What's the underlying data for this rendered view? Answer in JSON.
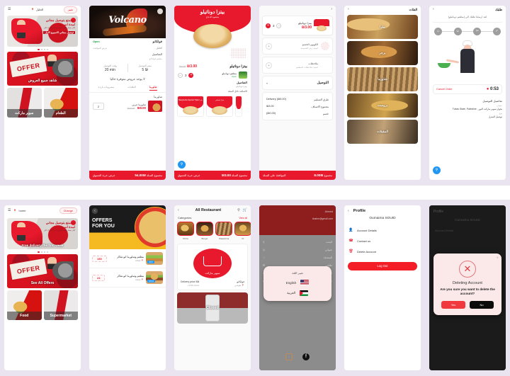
{
  "panels": {
    "home_ar": {
      "name": "home-arabic",
      "topbar": {
        "menu_icon": "hamburger-icon",
        "location_icon": "pin-icon",
        "location": "الخليل",
        "change_label": "تغيير"
      },
      "banner1": {
        "line1": "استمتع بتوصيل مجاني",
        "line2": "لمدة اسبوع",
        "line3": "اكثر بسعار قليلة متوفرة عندنا اشترك الان",
        "line4": "توصيل مجاني الاسبوع الاول",
        "overlay": ""
      },
      "banner2": {
        "stamp": "OFFER",
        "overlay": "شاهد جميع العروض"
      },
      "categories": [
        {
          "label": "الطعام"
        },
        {
          "label": "سوبر ماركت"
        }
      ]
    },
    "volcano": {
      "name": "restaurant-volcano",
      "hero_word": "Volcano",
      "restaurant_name": "فولكانو",
      "open_label": "Open",
      "location": "الخليل",
      "hours_label": "عرض المواقيت",
      "details_title": "التفاصيل",
      "details_sub": "مطعم فولكانو",
      "stats": [
        {
          "key": "سعر التوصيل",
          "value": "5 ₪"
        },
        {
          "key": "وقت التوصيل",
          "value": "20 min"
        }
      ],
      "note": "لا يوجد عروض متوفرة حاليا",
      "tabs": [
        {
          "label": "شاورما",
          "active": true
        },
        {
          "label": "الطلبات",
          "active": false
        },
        {
          "label": "مشروبات باردة",
          "active": false
        }
      ],
      "section_title": "شاورما",
      "product": {
        "name": "شاورما عربي",
        "price": "₪8.00",
        "old_price": "₪10.00",
        "qty": "2"
      },
      "footer": {
        "total_label": "مجموع السلة",
        "total": "₪54.00",
        "action": "عرض عربة التسوق"
      }
    },
    "pizza_detail": {
      "name": "product-detail-pizza",
      "hero_title": "بيتزا دوناتيلو",
      "hero_sub": "بحشوة الدجاج",
      "product_name": "بيتزا دوناتيلو",
      "price": "₪3.00",
      "old_price": "₪4.00",
      "restaurant": "مطعم دوناتيلو",
      "restaurant_status": "Open",
      "qty": "3",
      "details_title": "التفاصيل",
      "details_text": "بيتزا دوناتيلو",
      "details_note": "الاضافة داخل السلة",
      "related": [
        {
          "title": "بيتزا شيشي"
        },
        {
          "title": "بيتزا Margherita Special Triple"
        }
      ],
      "footer": {
        "total_label": "مجموع السلة",
        "total": "3.00₪",
        "action": "عرض عربة التسوق"
      }
    },
    "cart": {
      "name": "cart-checkout",
      "back_icon": "chevron-right-icon",
      "item": {
        "name": "بيتزا دوناتيلو",
        "price": "₪3.00",
        "qty": "3"
      },
      "coupon": {
        "title": "الكوبون الخصم",
        "sub": "اضف رمز القسيمة"
      },
      "notes": {
        "title": "ملاحظات",
        "sub": "اضف ملاحظات للمطعم"
      },
      "delivery_select": {
        "label": "التوصيل",
        "caret": "chevron-down-icon"
      },
      "summary": [
        {
          "key": "طرق التسليم",
          "value": "Delivery (₪5.00)"
        },
        {
          "key": "مجموع الاصناف",
          "value": "₪3.00"
        },
        {
          "key": "خصم",
          "value": "(₪0.00)"
        }
      ],
      "footer": {
        "total_label": "مجموع",
        "total": "₪8.00",
        "action": "الموافقة على السلة"
      }
    },
    "categories": {
      "name": "categories-list",
      "back_icon": "chevron-right-icon",
      "title": "الفئات",
      "items": [
        {
          "label": "بيتزا"
        },
        {
          "label": "برجر"
        },
        {
          "label": "شاورما"
        },
        {
          "label": "بروست"
        },
        {
          "label": "المقبلات"
        }
      ]
    },
    "tracking": {
      "name": "order-tracking",
      "back_icon": "chevron-right-icon",
      "title": "طلبك",
      "subtitle": "لقد ارسلنا طلبك الى (مطعم دوناتيلو)",
      "steps": [
        {
          "icon": "home-icon"
        },
        {
          "icon": "cook-icon"
        },
        {
          "icon": "utensils-icon"
        },
        {
          "icon": "check-icon"
        }
      ],
      "cancel_label": "Cancel Order",
      "timer": "0:53",
      "details_title": "تفاصيل التوصيل",
      "address_key": "عنوان",
      "address_value": "بجوار سوبر ماركت النور , Tubas State, Palestine",
      "type_key": "نوع",
      "type_value": "توصيل المنزل",
      "fab_icon": "search-icon"
    },
    "home_en": {
      "name": "home-english",
      "topbar": {
        "menu_icon": "hamburger-icon",
        "location_icon": "pin-icon",
        "location": "home",
        "change_label": "Change"
      },
      "banner1": {
        "line1": "استمتع بتوصيل مجاني",
        "line2": "لمدة اسبوع",
        "line3": "اكثر بسعار قليلة متوفرة عندنا اشترك الان",
        "overlay": "Free delivery the first week"
      },
      "banner2": {
        "stamp": "OFFER",
        "overlay": "See All Offers"
      },
      "categories": [
        {
          "label": "Food"
        },
        {
          "label": "Supermarket"
        }
      ]
    },
    "offers": {
      "name": "offers-for-you",
      "back_icon": "chevron-left-icon",
      "hero_line1": "OFFERS",
      "hero_line2": "FOR YOU",
      "rows": [
        {
          "name": "مطعم وشاورما ابو شاكر",
          "location": "tubas",
          "price": "150",
          "discount": "5 Off"
        },
        {
          "name": "مطعم وشاورما ابو شاكر",
          "location": "tubas",
          "price": "24",
          "discount": "24 Off"
        }
      ]
    },
    "all_restaurant": {
      "name": "all-restaurant",
      "back_icon": "chevron-left-icon",
      "title": "All Restaurant",
      "search_icon": "search-icon",
      "cart_icon": "cart-icon",
      "categories_label": "Categories",
      "view_all_label": "View all",
      "category_pills": [
        {
          "label": "Pizza"
        },
        {
          "label": "Burger"
        },
        {
          "label": "Shawarma"
        },
        {
          "label": "Pr"
        }
      ],
      "restaurant": {
        "logo_text": "سوبر ماركت",
        "name": "فولكانو",
        "location": "طوباس",
        "delivery_label": "Delivery price 5₪",
        "distance": "0.54.13 km"
      },
      "closed_label": "Closed"
    },
    "language": {
      "name": "language-drawer",
      "header_name": "Ahmed",
      "header_email": "tinahm@gmail.com",
      "menu": [
        {
          "label": "البحث",
          "icon": "search-icon"
        },
        {
          "label": "عنواني",
          "icon": "pin-icon"
        },
        {
          "label": "المفضلة",
          "icon": "heart-icon"
        },
        {
          "label": "طلباتي",
          "icon": "receipt-icon"
        },
        {
          "label": "الملف الشخصي",
          "icon": "user-icon"
        },
        {
          "label": "تغيير اللغة",
          "icon": "globe-icon"
        }
      ],
      "popup": {
        "title": "تغيير اللغة",
        "options": [
          {
            "label": "English",
            "flag": "us-flag-icon"
          },
          {
            "label": "العربية",
            "flag": "palestine-flag-icon"
          }
        ]
      },
      "social": [
        {
          "icon": "instagram-icon"
        },
        {
          "icon": "facebook-icon"
        }
      ]
    },
    "profile": {
      "name": "profile",
      "back_icon": "chevron-left-icon",
      "title": "Profile",
      "user_name": "Oumaima SOUID",
      "items": [
        {
          "label": "Account Details",
          "icon": "user-icon"
        },
        {
          "label": "Contact us",
          "icon": "phone-icon"
        },
        {
          "label": "Delete Account",
          "icon": "trash-icon"
        }
      ],
      "logout_label": "Log Out"
    },
    "delete_dialog": {
      "name": "delete-account-dialog",
      "ghost_title": "Profile",
      "ghost_name": "Oumaima SOUID",
      "ghost_item": "Account Details",
      "close_icon": "close-icon",
      "warn_icon": "x-circle-icon",
      "heading": "Deleting Account",
      "message": "Are you sure you want to delete the account?",
      "yes_label": "Yes",
      "no_label": "No"
    }
  },
  "colors": {
    "brand_red": "#e8192c",
    "panel_bg": "#e9e4ef",
    "dialog_bg": "#fbe9e9",
    "dim": "#1b1b1b"
  }
}
